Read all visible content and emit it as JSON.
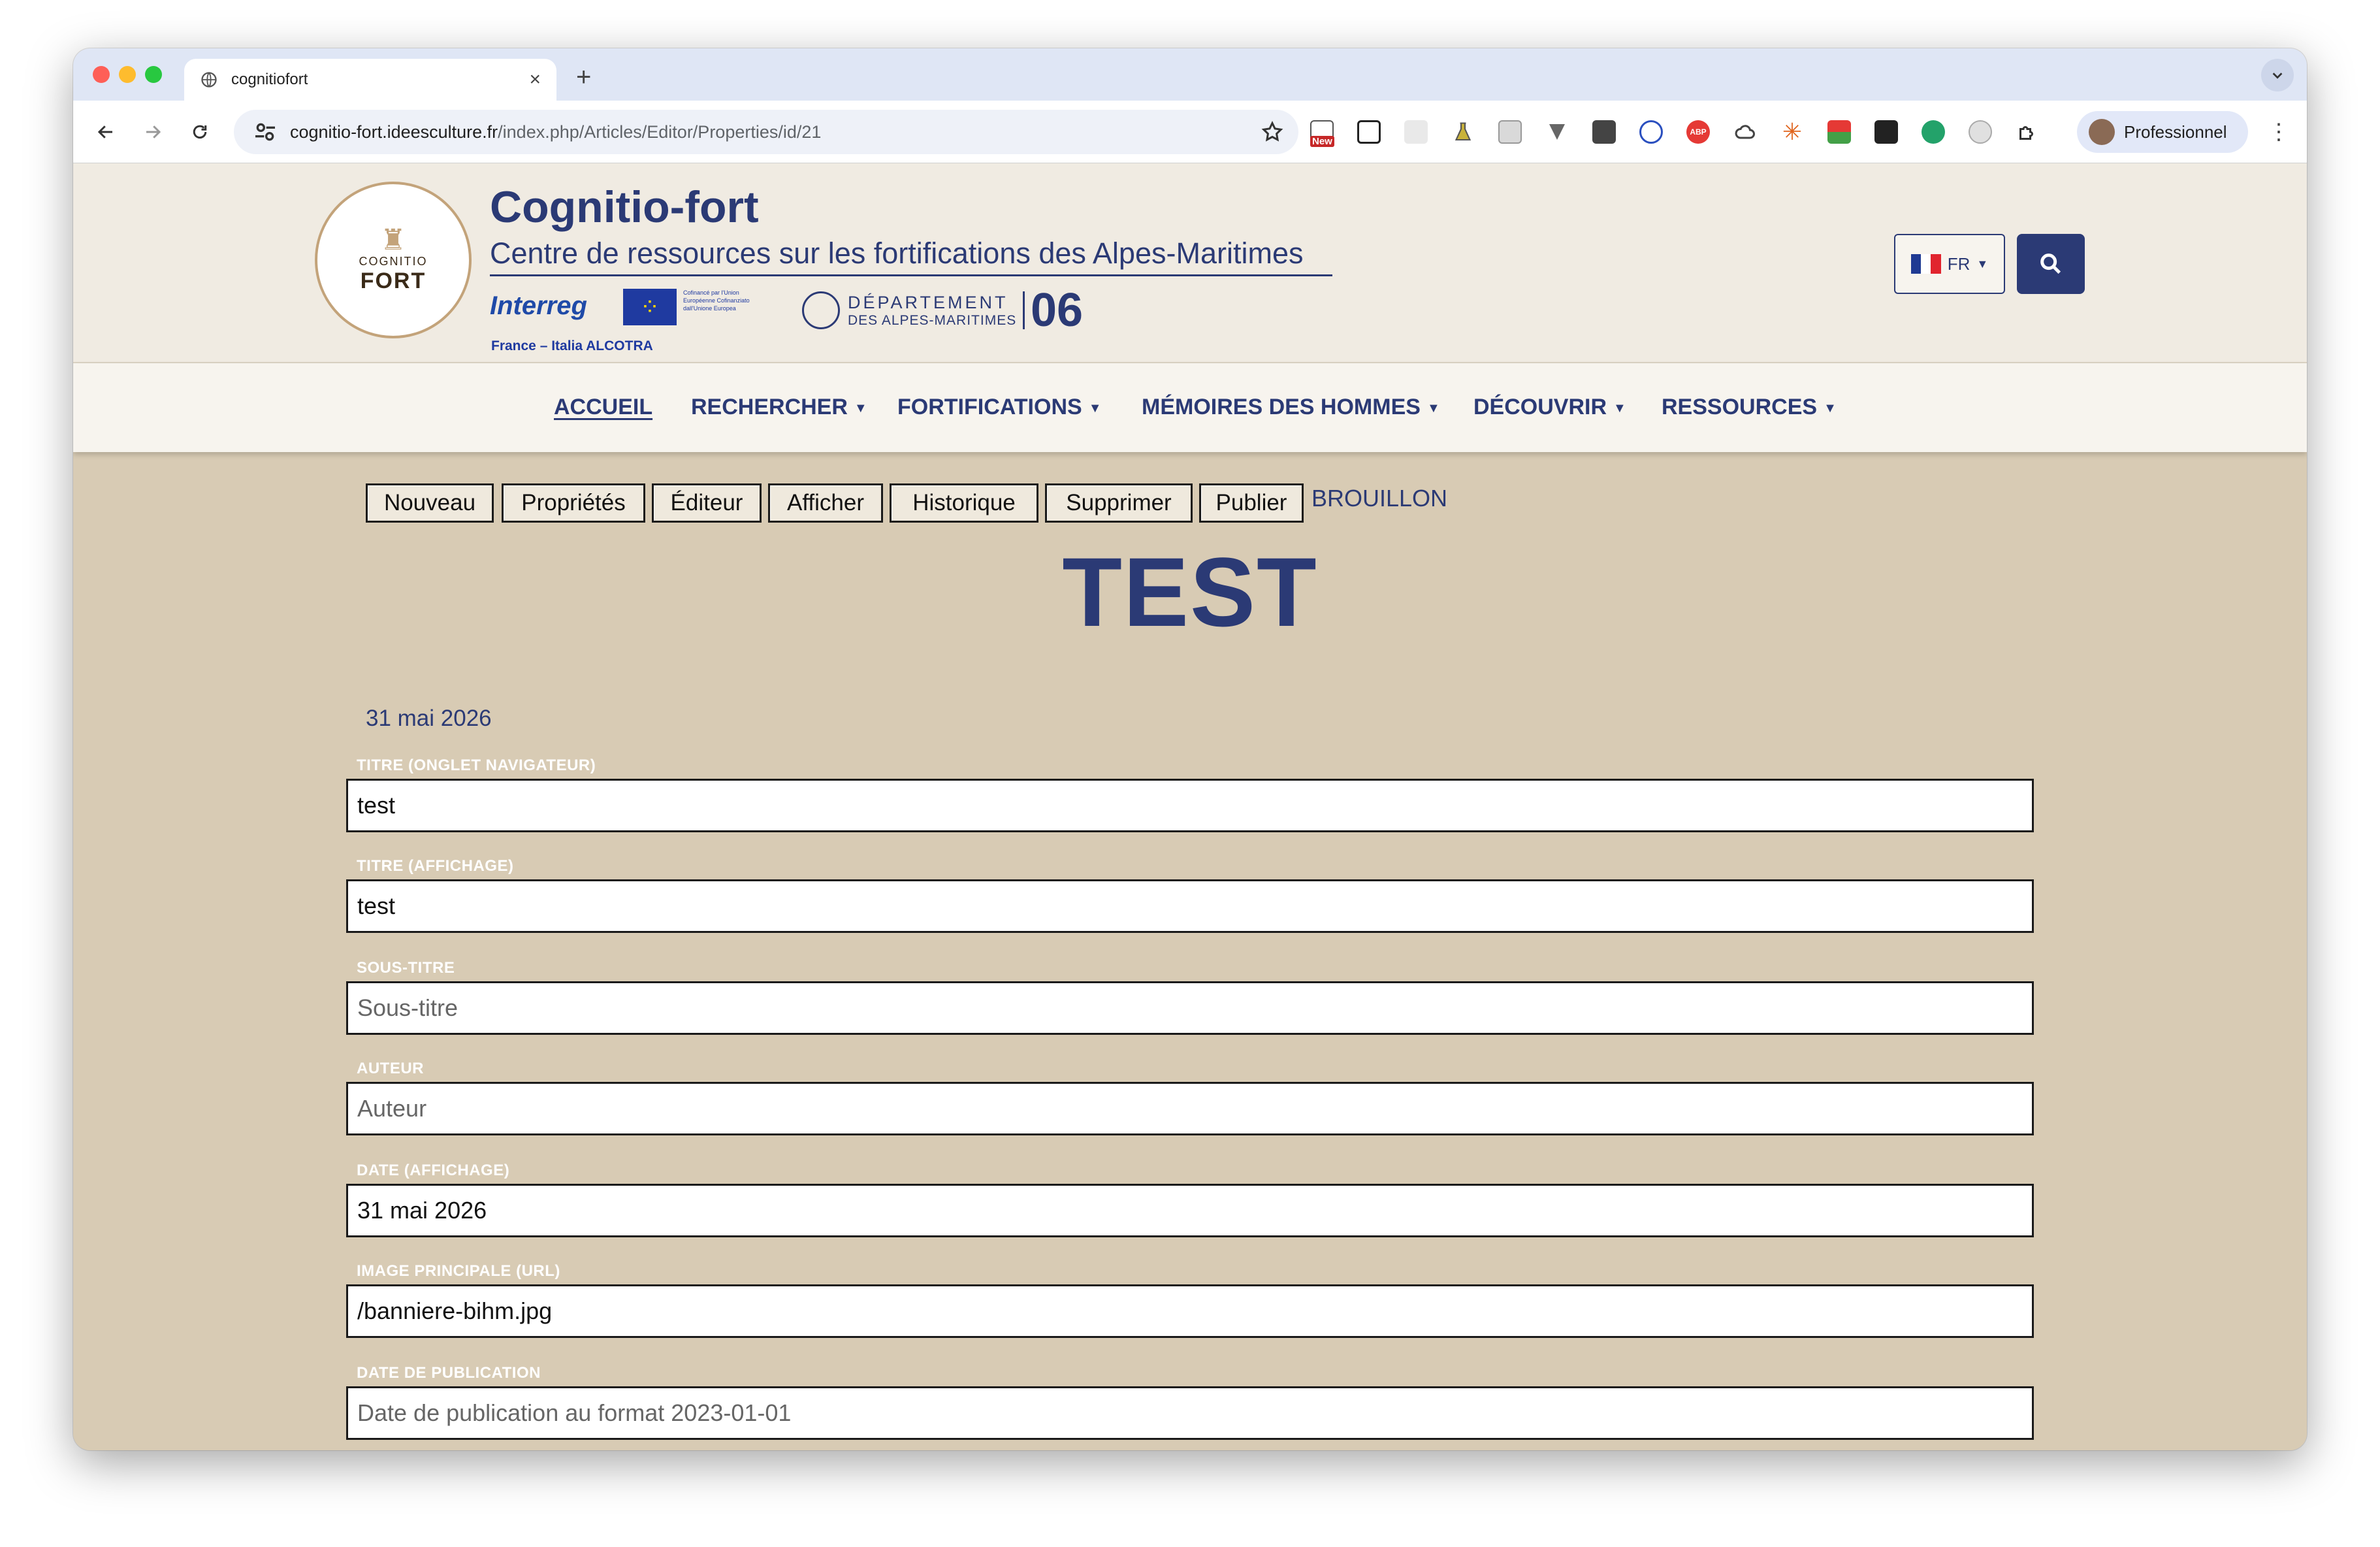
{
  "browser": {
    "tab_title": "cognitiofort",
    "url_host": "cognitio-fort.ideesculture.fr",
    "url_path": "/index.php/Articles/Editor/Properties/id/21",
    "profile_name": "Professionnel",
    "ext_badge": "New"
  },
  "site": {
    "title": "Cognitio-fort",
    "subtitle": "Centre de ressources sur les fortifications des Alpes-Maritimes",
    "logo_small": "COGNITIO",
    "logo_big": "FORT",
    "interreg": "Interreg",
    "eu_text": "Cofinancé par l'Union Européenne Cofinanziato dall'Unione Europea",
    "alcotra": "France – Italia ALCOTRA",
    "dept_line1": "DÉPARTEMENT",
    "dept_line2": "DES ALPES-MARITIMES",
    "dept_num": "06",
    "lang": "FR"
  },
  "nav": {
    "accueil": "ACCUEIL",
    "rechercher": "RECHERCHER",
    "fortifications": "FORTIFICATIONS",
    "memoires": "MÉMOIRES DES HOMMES",
    "decouvrir": "DÉCOUVRIR",
    "ressources": "RESSOURCES"
  },
  "editor": {
    "buttons": {
      "nouveau": "Nouveau",
      "proprietes": "Propriétés",
      "editeur": "Éditeur",
      "afficher": "Afficher",
      "historique": "Historique",
      "supprimer": "Supprimer",
      "publier": "Publier"
    },
    "status": "BROUILLON",
    "page_title": "TEST",
    "date": "31 mai 2026"
  },
  "form": {
    "titre_onglet": {
      "label": "TITRE (ONGLET NAVIGATEUR)",
      "value": "test",
      "placeholder": ""
    },
    "titre_affichage": {
      "label": "TITRE (AFFICHAGE)",
      "value": "test",
      "placeholder": ""
    },
    "sous_titre": {
      "label": "SOUS-TITRE",
      "value": "",
      "placeholder": "Sous-titre"
    },
    "auteur": {
      "label": "AUTEUR",
      "value": "",
      "placeholder": "Auteur"
    },
    "date_affichage": {
      "label": "DATE (AFFICHAGE)",
      "value": "31 mai 2026",
      "placeholder": ""
    },
    "image_principale": {
      "label": "IMAGE PRINCIPALE (URL)",
      "value": "/banniere-bihm.jpg",
      "placeholder": ""
    },
    "date_publication": {
      "label": "DATE DE PUBLICATION",
      "value": "",
      "placeholder": "Date de publication au format 2023-01-01"
    }
  },
  "colors": {
    "brand_blue": "#2b3a75",
    "page_bg": "#d8cbb4",
    "header_bg": "#f0ebe2"
  }
}
